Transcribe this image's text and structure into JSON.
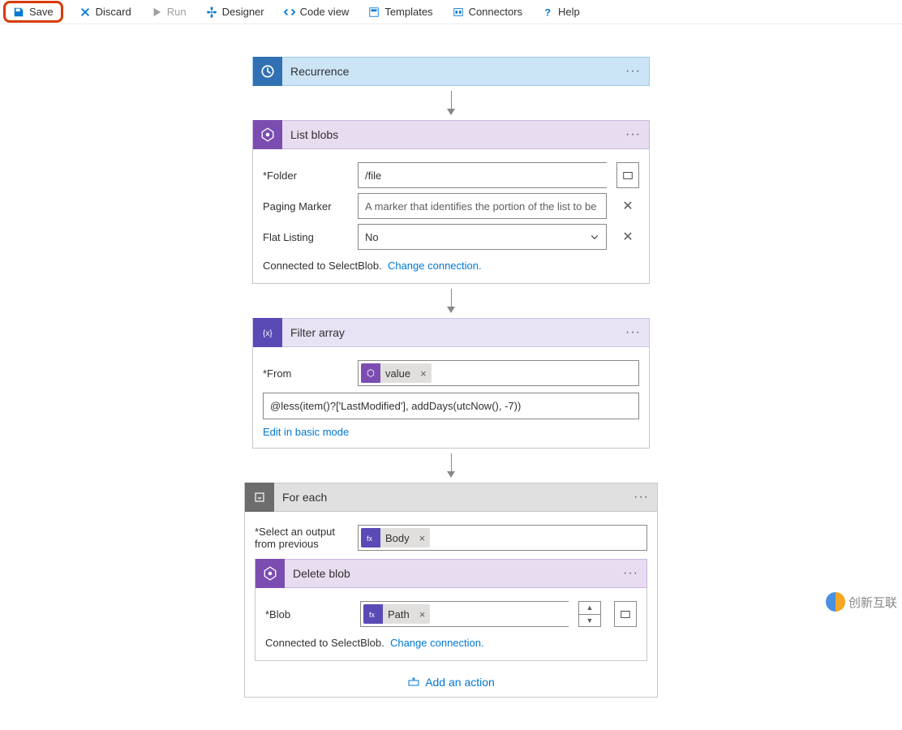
{
  "toolbar": {
    "save": "Save",
    "discard": "Discard",
    "run": "Run",
    "designer": "Designer",
    "codeview": "Code view",
    "templates": "Templates",
    "connectors": "Connectors",
    "help": "Help"
  },
  "recurrence": {
    "title": "Recurrence"
  },
  "listblobs": {
    "title": "List blobs",
    "folder_label": "*Folder",
    "folder_value": "/file",
    "paging_label": "Paging Marker",
    "paging_placeholder": "A marker that identifies the portion of the list to be",
    "flat_label": "Flat Listing",
    "flat_value": "No",
    "connected_text": "Connected to SelectBlob.",
    "change_link": "Change connection."
  },
  "filter": {
    "title": "Filter array",
    "from_label": "*From",
    "token_value": "value",
    "expression": "@less(item()?['LastModified'], addDays(utcNow(), -7))",
    "edit_link": "Edit in basic mode"
  },
  "foreach": {
    "title": "For each",
    "select_label": "*Select an output from previous",
    "body_token": "Body",
    "delete_title": "Delete blob",
    "blob_label": "*Blob",
    "path_token": "Path",
    "connected_text": "Connected to SelectBlob.",
    "change_link": "Change connection.",
    "add_action": "Add an action"
  },
  "watermark": "创新互联"
}
